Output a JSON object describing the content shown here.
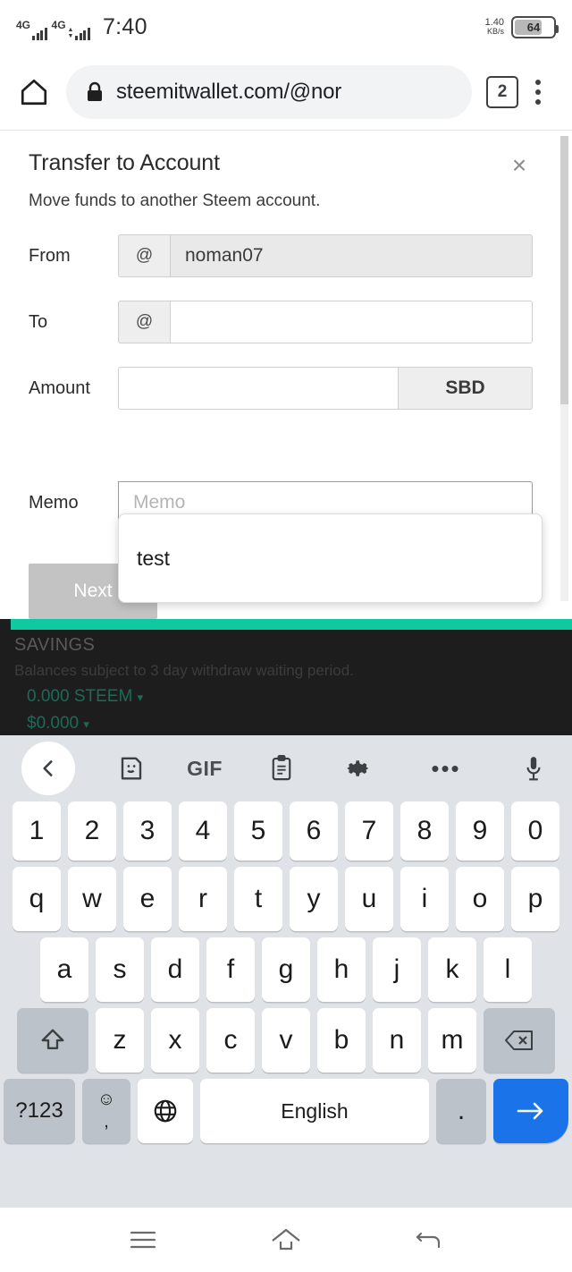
{
  "status_bar": {
    "network_type_1": "4G",
    "network_type_2": "4G",
    "time": "7:40",
    "data_rate": "1.40",
    "data_unit": "KB/s",
    "battery_percent": "64"
  },
  "browser": {
    "home_icon": "home-icon",
    "lock_icon": "lock-icon",
    "url": "steemitwallet.com/@nor",
    "tab_count": "2",
    "menu_icon": "kebab-menu-icon"
  },
  "modal": {
    "title": "Transfer to Account",
    "subtitle": "Move funds to another Steem account.",
    "close_label": "×",
    "fields": [
      {
        "label": "From",
        "addon": "@",
        "value": "noman07",
        "placeholder": "",
        "disabled": true
      },
      {
        "label": "To",
        "addon": "@",
        "value": "",
        "placeholder": "",
        "disabled": false
      },
      {
        "label": "Amount",
        "value": "",
        "placeholder": "",
        "currency": "SBD"
      },
      {
        "label": "Memo",
        "value": "",
        "placeholder": "Memo",
        "disabled": false
      }
    ],
    "submit_label": "Next"
  },
  "suggestion": {
    "text": "test"
  },
  "background_page": {
    "section_title": "SAVINGS",
    "note": "Balances subject to 3 day withdraw waiting period.",
    "balance_steem": "0.000 STEEM",
    "balance_usd": "$0.000",
    "caret": "▾",
    "accent_color": "#0fc9a0"
  },
  "keyboard": {
    "toolbar": [
      {
        "name": "back-chevron-icon",
        "glyph": "‹"
      },
      {
        "name": "sticker-icon",
        "glyph": ""
      },
      {
        "name": "gif-icon",
        "glyph": "GIF"
      },
      {
        "name": "clipboard-icon",
        "glyph": ""
      },
      {
        "name": "settings-gear-icon",
        "glyph": ""
      },
      {
        "name": "overflow-dots-icon",
        "glyph": "•••"
      },
      {
        "name": "microphone-icon",
        "glyph": ""
      }
    ],
    "row_numbers": [
      "1",
      "2",
      "3",
      "4",
      "5",
      "6",
      "7",
      "8",
      "9",
      "0"
    ],
    "row_top": [
      "q",
      "w",
      "e",
      "r",
      "t",
      "y",
      "u",
      "i",
      "o",
      "p"
    ],
    "row_mid": [
      "a",
      "s",
      "d",
      "f",
      "g",
      "h",
      "j",
      "k",
      "l"
    ],
    "row_bottom": [
      "z",
      "x",
      "c",
      "v",
      "b",
      "n",
      "m"
    ],
    "shift_label": "⇧",
    "backspace_label": "⌧",
    "symbols_label": "?123",
    "emoji_label": "☺",
    "comma_label": ",",
    "globe_label": "⊕",
    "space_label": "English",
    "period_label": ".",
    "enter_label": "→",
    "enter_color": "#1a73e8"
  },
  "nav_bar": {
    "recents": "recents-icon",
    "home": "home-icon",
    "back": "back-icon"
  }
}
